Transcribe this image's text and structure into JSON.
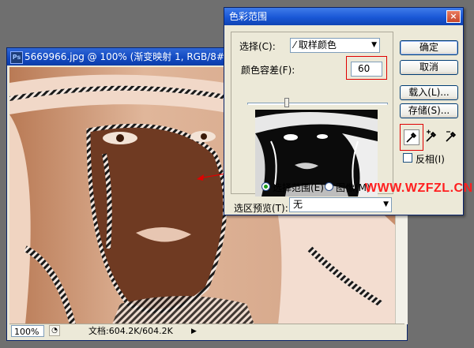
{
  "document": {
    "title": "5669966.jpg @ 100% (渐变映射 1, RGB/8#)",
    "icon_text": "Ps",
    "zoom": "100%",
    "doc_size": "文档:604.2K/604.2K"
  },
  "dialog": {
    "title": "色彩范围",
    "close_glyph": "×",
    "select_label": "选择(C):",
    "select_value": "取样颜色",
    "fuzziness_label": "颜色容差(F):",
    "fuzziness_value": "60",
    "fuzziness_percent": 0.28,
    "radio_selection": "选择范围(E)",
    "radio_image": "图像(M)",
    "preview_label": "选区预览(T):",
    "preview_value": "无",
    "buttons": {
      "ok": "确定",
      "cancel": "取消",
      "load": "载入(L)...",
      "save": "存储(S)..."
    },
    "invert_label": "反相(I)"
  },
  "watermark": "WWW.WZFZL.CN",
  "colors": {
    "highlight": "#e00000",
    "title_bar": "#1957d6",
    "image_tone": "#c99a7b"
  }
}
